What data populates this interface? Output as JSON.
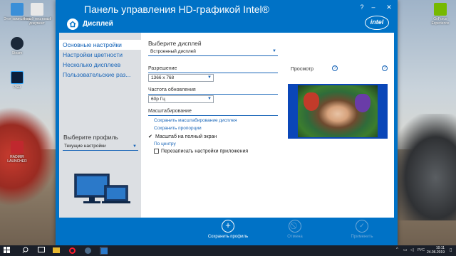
{
  "desktop": {
    "icons": [
      {
        "label": "Этот компьютер",
        "name": "this-pc"
      },
      {
        "label": "Новый текстовый документ",
        "name": "text-document"
      },
      {
        "label": "Steam",
        "name": "steam"
      },
      {
        "label": "PSD",
        "name": "photoshop"
      },
      {
        "label": "RADMIR LAUNCHER",
        "name": "radmir-launcher"
      },
      {
        "label": "GeForce Experience",
        "name": "geforce-experience"
      }
    ]
  },
  "window": {
    "title": "Панель управления HD-графикой Intel®",
    "section": "Дисплей",
    "logo": "intel",
    "controls": {
      "help": "?",
      "minimize": "–",
      "maximize": "□",
      "close": "✕"
    }
  },
  "sidebar": {
    "items": [
      {
        "label": "Основные настройки",
        "active": true
      },
      {
        "label": "Настройки цветности",
        "active": false
      },
      {
        "label": "Несколько дисплеев",
        "active": false
      },
      {
        "label": "Пользовательские раз...",
        "active": false
      }
    ],
    "profile_label": "Выберите профиль",
    "profile_value": "Текущие настройки"
  },
  "main": {
    "display_label": "Выберите дисплей",
    "display_value": "Встроенный дисплей",
    "resolution_label": "Разрешение",
    "resolution_value": "1366 x 768",
    "refresh_label": "Частота обновления",
    "refresh_value": "60p Гц",
    "scaling_label": "Масштабирование",
    "scaling_options": [
      {
        "label": "Сохранить масштабирование дисплея",
        "type": "link"
      },
      {
        "label": "Сохранить пропорции",
        "type": "link"
      },
      {
        "label": "Масштаб на полный экран",
        "type": "checked"
      },
      {
        "label": "По центру",
        "type": "link"
      }
    ],
    "override_label": "Перезаписать настройки приложения",
    "preview_label": "Просмотр"
  },
  "footer": {
    "save_profile": "Сохранить профиль",
    "cancel": "Отмена",
    "apply": "Применить"
  },
  "taskbar": {
    "language": "РУС",
    "time": "10:11",
    "date": "24.06.2019"
  },
  "colors": {
    "accent": "#0072c6",
    "link": "#1a66b8",
    "sidebar_bg": "#dcdfe3"
  }
}
